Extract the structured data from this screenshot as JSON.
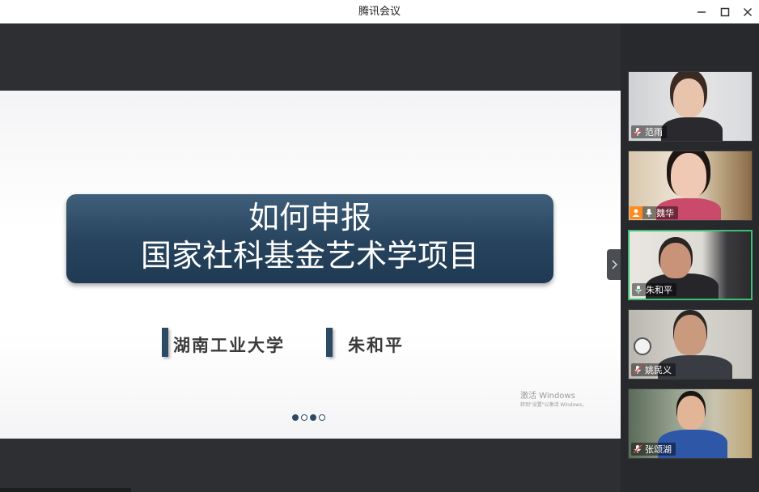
{
  "window": {
    "title": "腾讯会议"
  },
  "slide": {
    "title_line1": "如何申报",
    "title_line2": "国家社科基金艺术学项目",
    "university": "湖南工业大学",
    "presenter": "朱和平",
    "pagination": {
      "total": 4,
      "current": 3
    },
    "watermark_line1": "激活 Windows",
    "watermark_line2": "转到\"设置\"以激活 Windows。"
  },
  "participants": [
    {
      "name": "范雨",
      "mic": "muted"
    },
    {
      "name": "魏华",
      "mic": "on",
      "host_badge": true
    },
    {
      "name": "朱和平",
      "mic": "speaking",
      "active": true
    },
    {
      "name": "姚民义",
      "mic": "muted"
    },
    {
      "name": "张颂湖",
      "mic": "muted"
    }
  ],
  "colors": {
    "active_speaker": "#3fbf74",
    "banner": "#27435d",
    "host_badge": "#ff8a1f",
    "mic_muted": "#e04848"
  }
}
